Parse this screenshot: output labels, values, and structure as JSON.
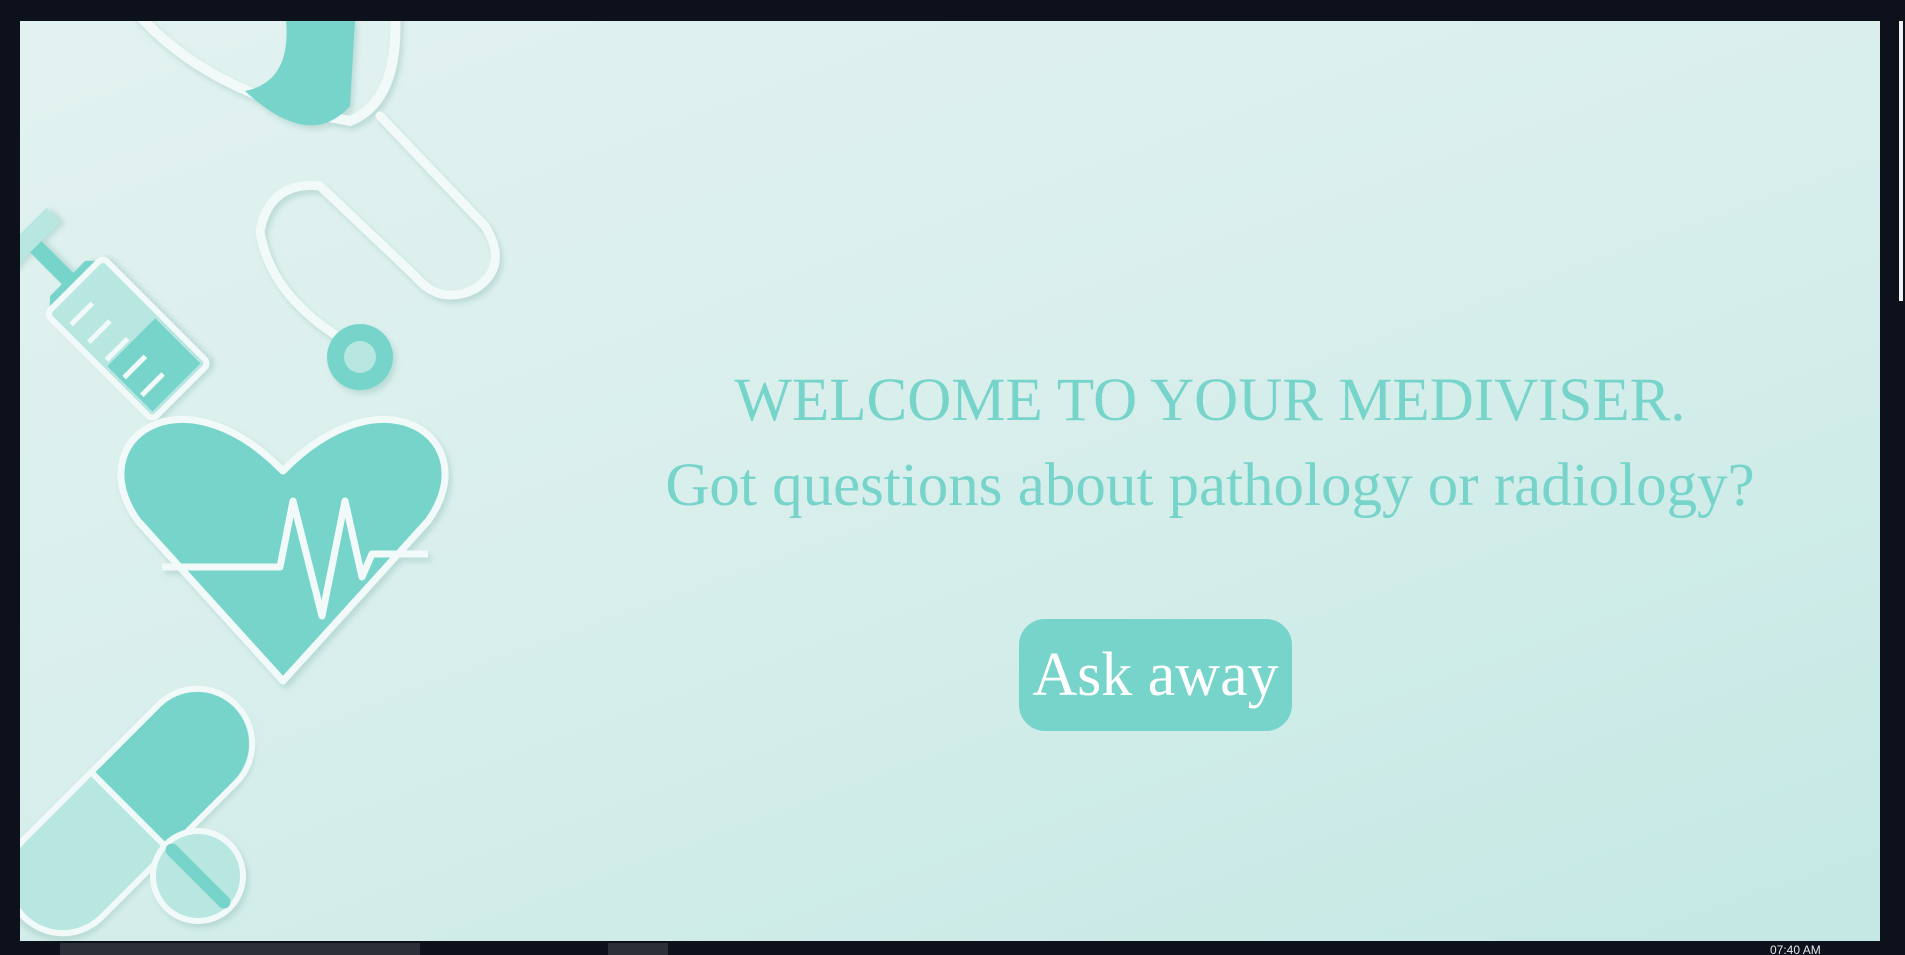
{
  "hero": {
    "title": "WELCOME TO YOUR MEDIVISER.",
    "subtitle": "Got questions about pathology or radiology?",
    "button_label": "Ask away"
  },
  "illustration": {
    "icons": [
      "stethoscope-icon",
      "syringe-icon",
      "heartbeat-icon",
      "pill-capsule-icon",
      "pill-tablet-icon"
    ]
  },
  "taskbar": {
    "clock": "07:40 AM"
  },
  "colors": {
    "accent": "#77d4ca",
    "accent_light": "#b8e6e1",
    "background": "#d9efec",
    "frame": "#0c111b",
    "outline": "#f2faf9"
  }
}
